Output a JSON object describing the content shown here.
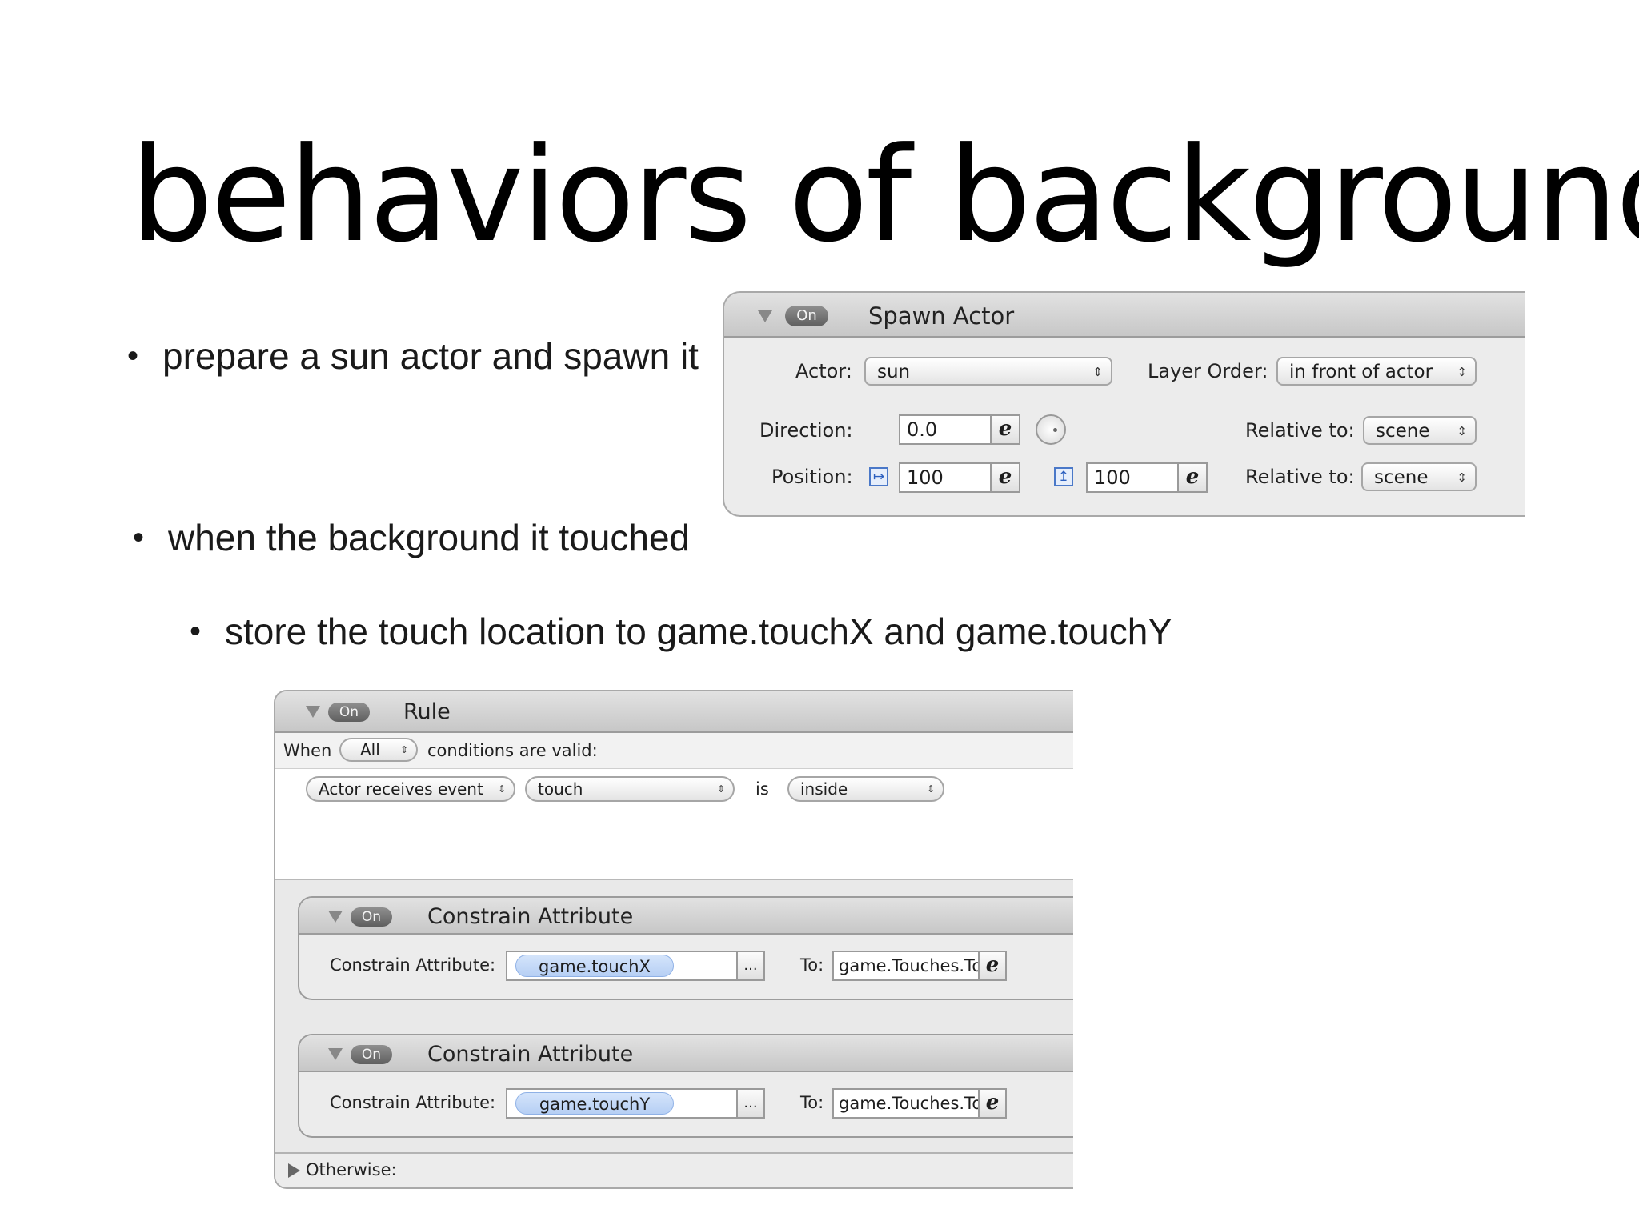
{
  "slide": {
    "title": "behaviors of background",
    "bullets": [
      "prepare a sun actor and spawn it",
      "when the background it touched",
      "store the touch location to game.touchX and game.touchY"
    ],
    "bullet_symbol": "•"
  },
  "spawn_panel": {
    "on_label": "On",
    "title": "Spawn Actor",
    "actor_label": "Actor:",
    "actor_value": "sun",
    "layer_order_label": "Layer Order:",
    "layer_order_value": "in front of actor",
    "direction_label": "Direction:",
    "direction_value": "0.0",
    "relative_label_1": "Relative to:",
    "relative_value_1": "scene",
    "position_label": "Position:",
    "pos_x_value": "100",
    "pos_y_value": "100",
    "relative_label_2": "Relative to:",
    "relative_value_2": "scene",
    "expr_glyph": "e",
    "popup_arrow": "⇕",
    "x_axis_glyph": "↦",
    "y_axis_glyph": "↥"
  },
  "rule_panel": {
    "on_label": "On",
    "title": "Rule",
    "when_label": "When",
    "when_value": "All",
    "conditions_label": "conditions are valid:",
    "condition_1": "Actor receives event",
    "condition_2": "touch",
    "is_label": "is",
    "condition_3": "inside",
    "constrain_1": {
      "on_label": "On",
      "title": "Constrain Attribute",
      "attr_label": "Constrain Attribute:",
      "attr_value": "game.touchX",
      "more": "...",
      "to_label": "To:",
      "to_value": "game.Touches.To"
    },
    "constrain_2": {
      "on_label": "On",
      "title": "Constrain Attribute",
      "attr_label": "Constrain Attribute:",
      "attr_value": "game.touchY",
      "more": "...",
      "to_label": "To:",
      "to_value": "game.Touches.To"
    },
    "otherwise_label": "Otherwise:"
  }
}
